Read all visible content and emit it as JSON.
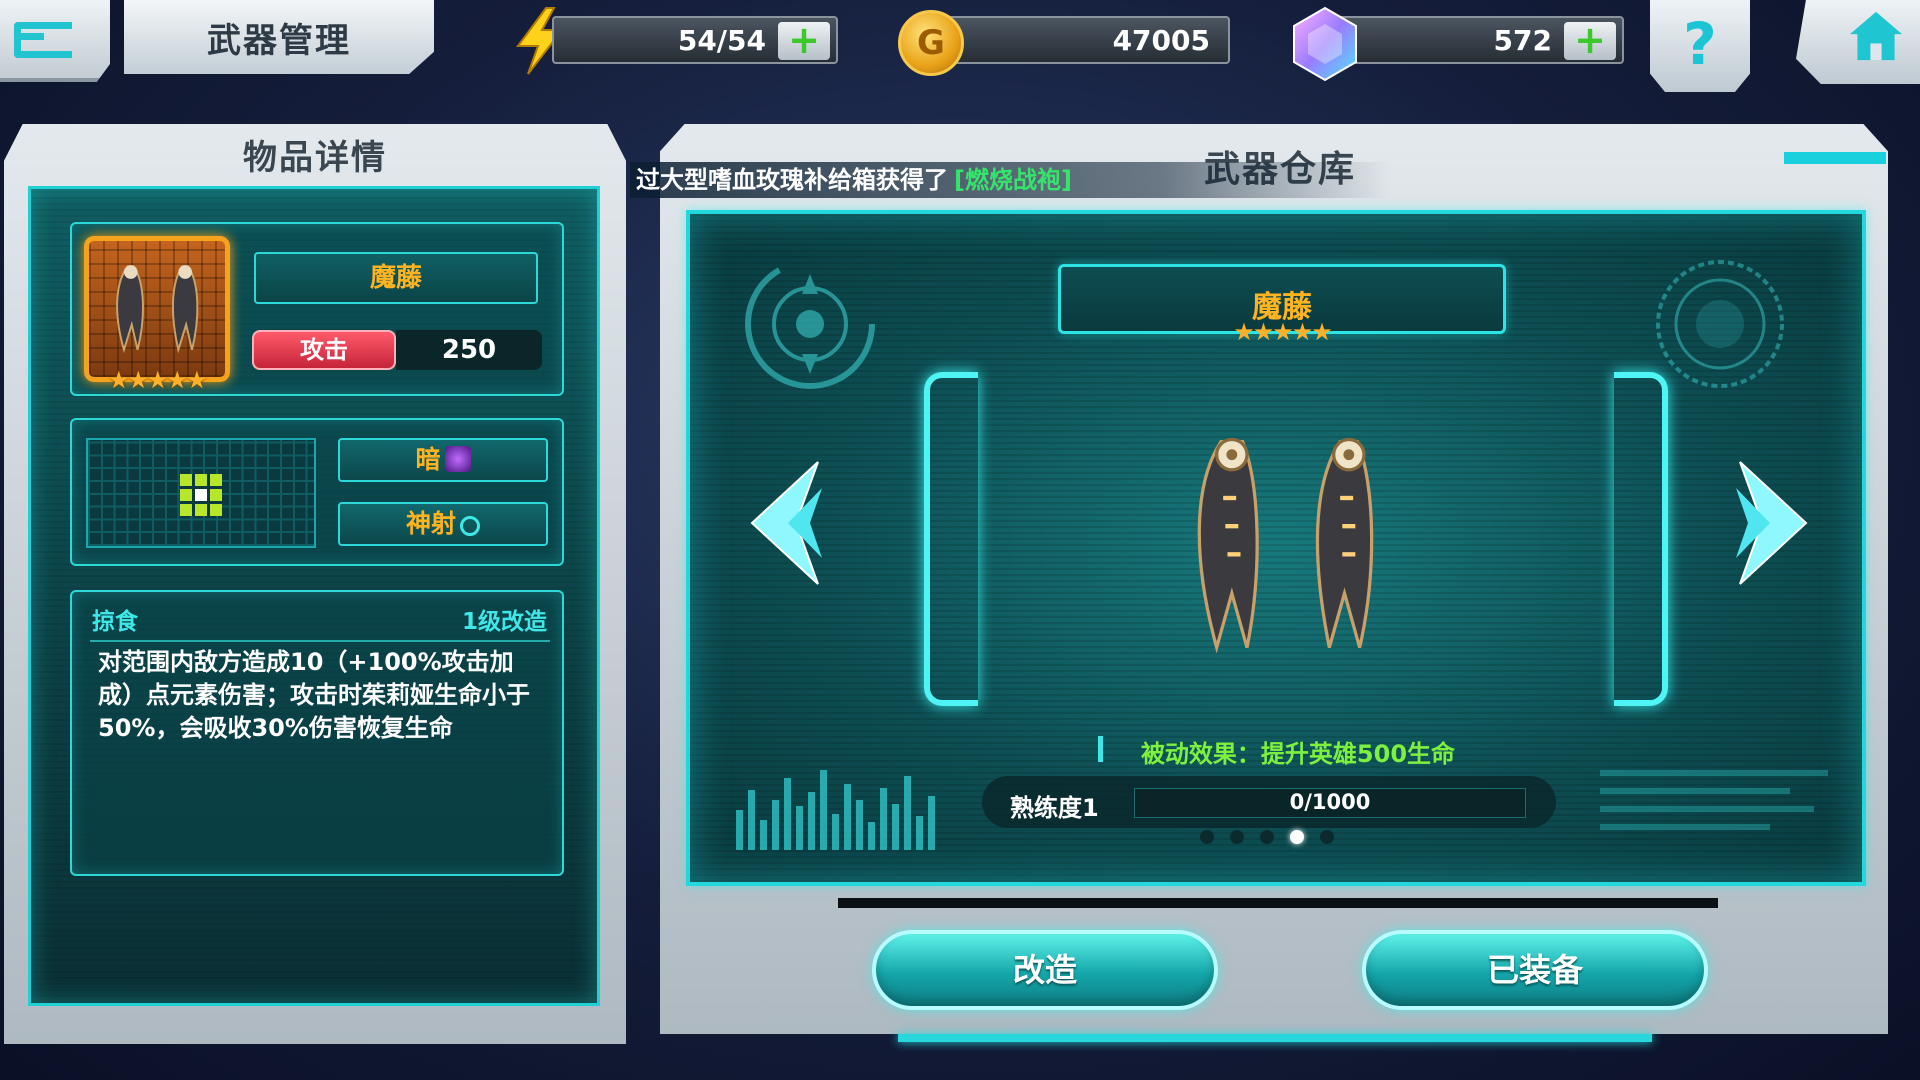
{
  "header": {
    "title": "武器管理",
    "energy": "54/54",
    "gold": "47005",
    "gems": "572",
    "help_label": "?"
  },
  "item_detail": {
    "panel_title": "物品详情",
    "weapon_name": "魔藤",
    "stars": "★★★★★",
    "star_count": 5,
    "stat_label": "攻击",
    "stat_value": "250",
    "element_label": "暗",
    "type_label": "神射",
    "skill_name": "掠食",
    "skill_level": "1级改造",
    "skill_description": "对范围内敌方造成10（+100%攻击加成）点元素伤害；攻击时茱莉娅生命小于50%，会吸收30%伤害恢复生命"
  },
  "warehouse": {
    "panel_title": "武器仓库",
    "notice_text": "过大型嗜血玫瑰补给箱获得了",
    "notice_item": "[燃烧战袍]",
    "weapon_name": "魔藤",
    "stars": "★★★★★",
    "passive_effect": "被动效果：提升英雄500生命",
    "proficiency_label": "熟练度1",
    "proficiency_text": "0/1000",
    "proficiency_fraction": 0,
    "page_count": 5,
    "active_page": 4,
    "upgrade_button": "改造",
    "equipped_button": "已装备"
  },
  "colors": {
    "accent": "#23d8dc",
    "name_gold": "#ffb321",
    "passive_green": "#7ef03e",
    "notice_green": "#35e46a",
    "attack_red": "#d9304a"
  },
  "icons": [
    "back-icon",
    "lightning-icon",
    "gold-coin-icon",
    "gem-icon",
    "plus-icon",
    "help-icon",
    "home-icon",
    "dark-element-icon",
    "crosshair-icon",
    "arrow-left-icon",
    "arrow-right-icon"
  ]
}
